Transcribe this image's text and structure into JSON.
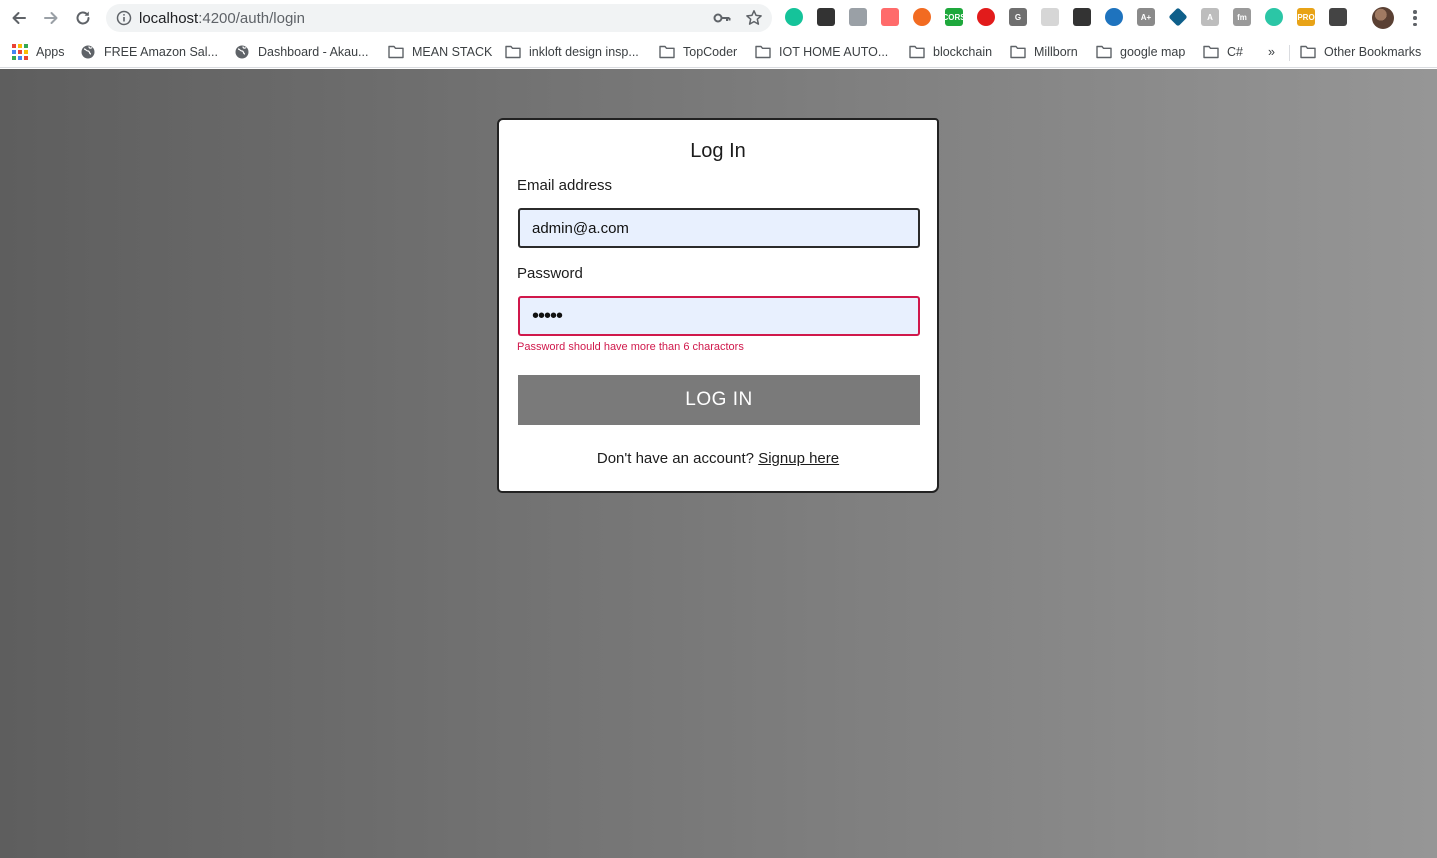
{
  "browser": {
    "url_host": "localhost",
    "url_path": ":4200/auth/login",
    "extensions": [
      {
        "name": "grammarly-icon",
        "color": "#15c39a",
        "text": ""
      },
      {
        "name": "eyedropper-icon",
        "color": "#333333",
        "text": ""
      },
      {
        "name": "camera-icon",
        "color": "#9aa0a6",
        "text": ""
      },
      {
        "name": "record-icon",
        "color": "#ff6b6b",
        "text": ""
      },
      {
        "name": "lifebuoy-icon",
        "color": "#f26b21",
        "text": ""
      },
      {
        "name": "cors-icon",
        "color": "#1ea83c",
        "text": "CORS"
      },
      {
        "name": "adblock-icon",
        "color": "#e21b1b",
        "text": ""
      },
      {
        "name": "g-extension-icon",
        "color": "#6f6f6f",
        "text": "G"
      },
      {
        "name": "grid-extension-icon",
        "color": "#d6d6d6",
        "text": ""
      },
      {
        "name": "incognito-icon",
        "color": "#333333",
        "text": ""
      },
      {
        "name": "globe-extension-icon",
        "color": "#1e73be",
        "text": ""
      },
      {
        "name": "ascout-icon",
        "color": "#8a8a8a",
        "text": "A+"
      },
      {
        "name": "diamond-extension-icon",
        "color": "#0e5f8a",
        "text": ""
      },
      {
        "name": "font-extension-icon",
        "color": "#bdbdbd",
        "text": "A"
      },
      {
        "name": "fm-extension-icon",
        "color": "#9a9a9a",
        "text": "fm"
      },
      {
        "name": "ruler-extension-icon",
        "color": "#2bc6a6",
        "text": ""
      },
      {
        "name": "pro-extension-icon",
        "color": "#e8a317",
        "text": "PRO"
      },
      {
        "name": "monitor-extension-icon",
        "color": "#444444",
        "text": ""
      }
    ]
  },
  "bookmarks": [
    {
      "label": "Apps",
      "icon": "apps-grid-icon"
    },
    {
      "label": "FREE Amazon Sal...",
      "icon": "globe-icon"
    },
    {
      "label": "Dashboard - Akau...",
      "icon": "globe-icon"
    },
    {
      "label": "MEAN STACK",
      "icon": "folder-icon"
    },
    {
      "label": "inkloft design insp...",
      "icon": "folder-icon"
    },
    {
      "label": "TopCoder",
      "icon": "folder-icon"
    },
    {
      "label": "IOT HOME AUTO...",
      "icon": "folder-icon"
    },
    {
      "label": "blockchain",
      "icon": "folder-icon"
    },
    {
      "label": "Millborn",
      "icon": "folder-icon"
    },
    {
      "label": "google map",
      "icon": "folder-icon"
    },
    {
      "label": "C#",
      "icon": "folder-icon"
    }
  ],
  "bookmarks_overflow": "»",
  "other_bookmarks": "Other Bookmarks",
  "login": {
    "title": "Log In",
    "email_label": "Email address",
    "email_value": "admin@a.com",
    "password_label": "Password",
    "password_value": "•••••",
    "password_error": "Password should have more than 6 charactors",
    "submit_label": "LOG IN",
    "signup_prompt": "Don't have an account?",
    "signup_link": "Signup here"
  },
  "colors": {
    "error": "#d0184b",
    "button": "#7a7a7a",
    "autofill_bg": "#e8f0fe"
  }
}
